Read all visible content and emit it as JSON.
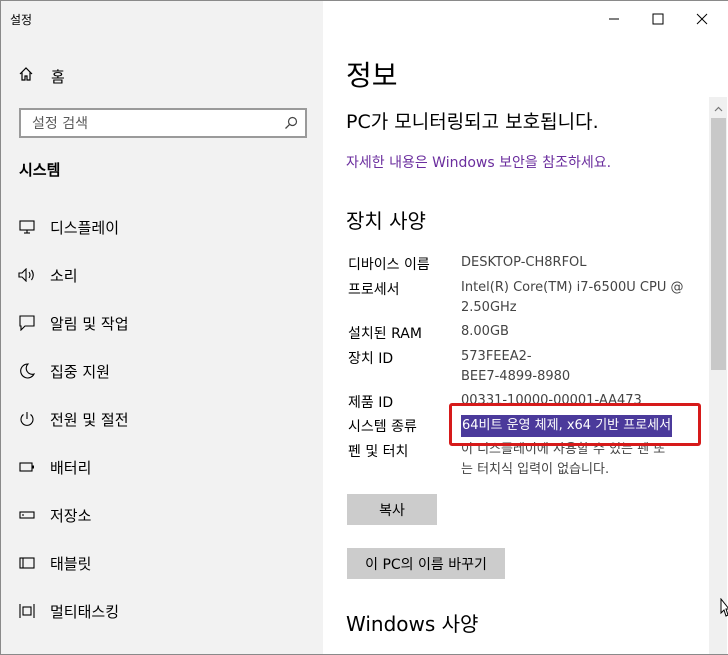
{
  "window": {
    "title": "설정"
  },
  "sidebar": {
    "home_label": "홈",
    "search_placeholder": "설정 검색",
    "section_label": "시스템",
    "items": [
      {
        "label": "디스플레이",
        "icon": "monitor-icon"
      },
      {
        "label": "소리",
        "icon": "speaker-icon"
      },
      {
        "label": "알림 및 작업",
        "icon": "notification-icon"
      },
      {
        "label": "집중 지원",
        "icon": "moon-icon"
      },
      {
        "label": "전원 및 절전",
        "icon": "power-icon"
      },
      {
        "label": "배터리",
        "icon": "battery-icon"
      },
      {
        "label": "저장소",
        "icon": "storage-icon"
      },
      {
        "label": "태블릿",
        "icon": "tablet-icon"
      },
      {
        "label": "멀티태스킹",
        "icon": "multitasking-icon"
      }
    ]
  },
  "main": {
    "title": "정보",
    "protection_status": "PC가 모니터링되고 보호됩니다.",
    "security_link": "자세한 내용은 Windows 보안을 참조하세요.",
    "device_spec_heading": "장치 사양",
    "specs": [
      {
        "label": "디바이스 이름",
        "value": "DESKTOP-CH8RFOL"
      },
      {
        "label": "프로세서",
        "value": "Intel(R) Core(TM) i7-6500U CPU @",
        "value2": "2.50GHz"
      },
      {
        "label": "설치된 RAM",
        "value": "8.00GB"
      },
      {
        "label": "장치 ID",
        "value": "573FEEA2-",
        "value2": "BEE7-4899-8980"
      },
      {
        "label": "제품 ID",
        "value": "00331-10000-00001-AA473"
      },
      {
        "label": "시스템 종류",
        "value": "64비트 운영 체제, x64 기반 프로세서"
      },
      {
        "label": "펜 및 터치",
        "value": "이 디스플레이에 사용할 수 있는 펜 또",
        "value2": "는 터치식 입력이 없습니다."
      }
    ],
    "copy_button": "복사",
    "rename_button": "이 PC의 이름 바꾸기",
    "windows_spec_heading": "Windows 사양"
  },
  "colors": {
    "link": "#6b2e9e",
    "selection": "#4b3a9b",
    "highlight_border": "#d61a1a",
    "sidebar_bg": "#f2f2f2",
    "button_bg": "#cccccc"
  }
}
